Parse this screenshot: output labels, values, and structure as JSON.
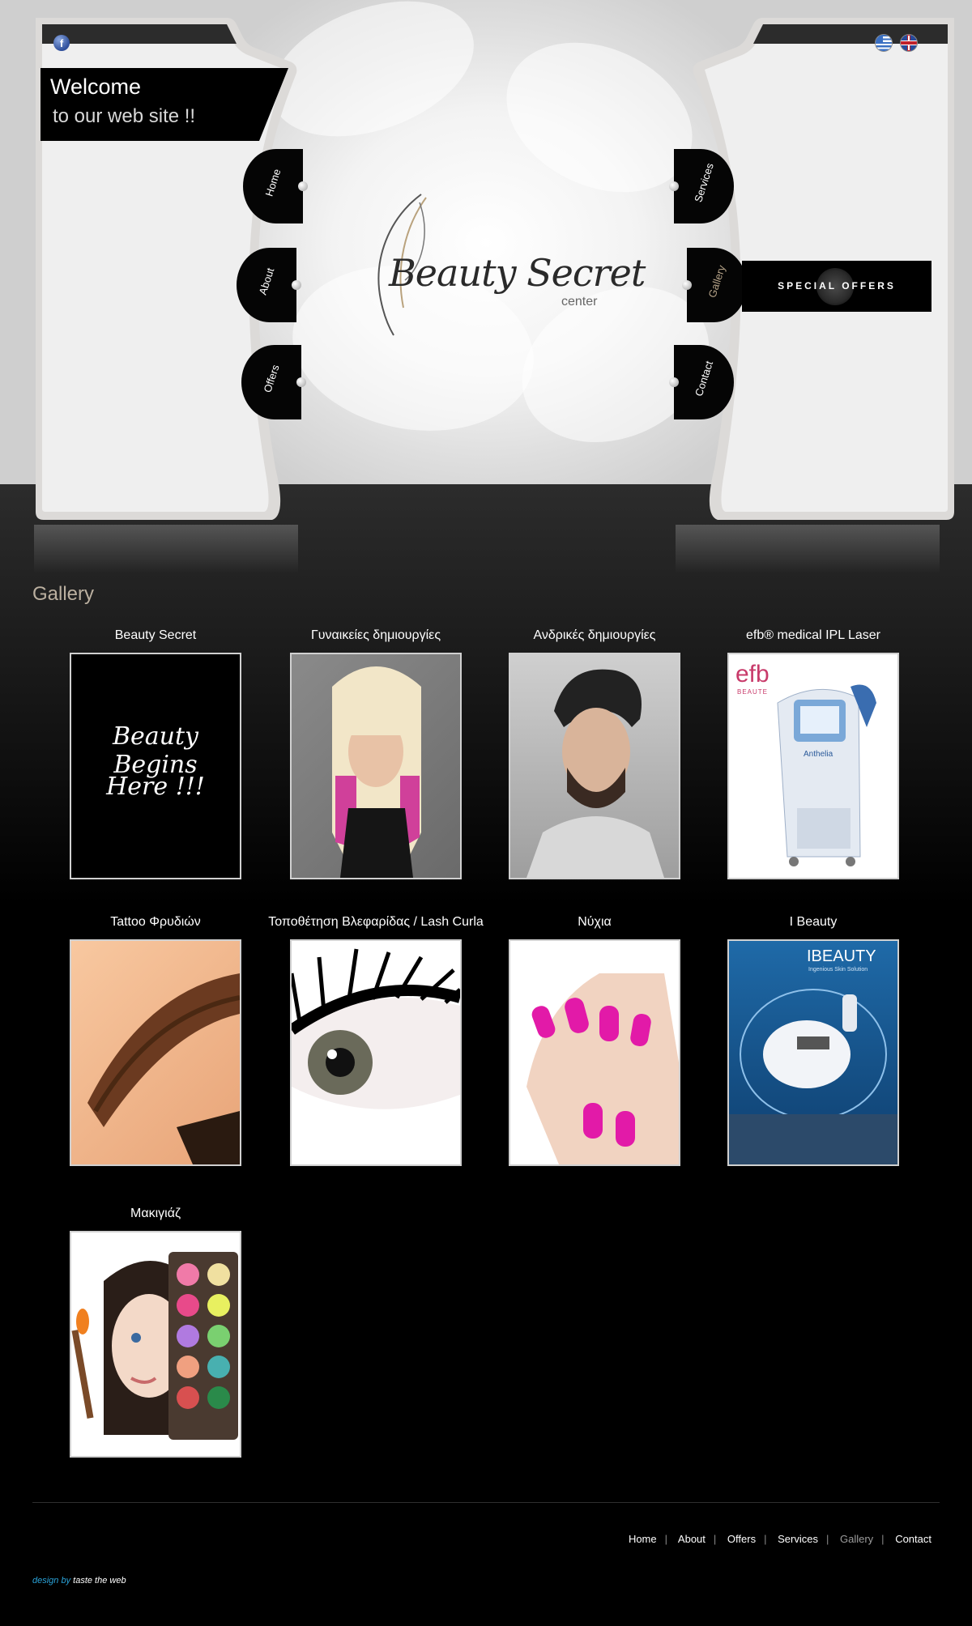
{
  "header": {
    "welcome_line1": "Welcome",
    "welcome_line2": "to our web site !!",
    "languages": [
      "el",
      "en"
    ],
    "facebook_icon": "facebook-icon"
  },
  "nav": {
    "left_tabs": [
      {
        "label": "Home"
      },
      {
        "label": "About"
      },
      {
        "label": "Offers"
      }
    ],
    "right_tabs": [
      {
        "label": "Services"
      },
      {
        "label": "Gallery",
        "active": true
      },
      {
        "label": "Contact"
      }
    ]
  },
  "logo": {
    "name": "Beauty Secret",
    "sub": "center"
  },
  "special_offers": "SPECIAL OFFERS",
  "gallery": {
    "title": "Gallery",
    "items": [
      {
        "caption": "Beauty Secret",
        "art_text_1": "Beauty Begins",
        "art_text_2": "Here !!!"
      },
      {
        "caption": "Γυναικείες δημιουργίες"
      },
      {
        "caption": "Ανδρικές δημιουργίες"
      },
      {
        "caption": "efb® medical IPL Laser",
        "art_brand": "efb",
        "art_sub": "BEAUTE",
        "art_device": "Anthelia"
      },
      {
        "caption": "Tattoo Φρυδιών"
      },
      {
        "caption": "Τοποθέτηση Βλεφαρίδας / Lash Curla"
      },
      {
        "caption": "Νύχια"
      },
      {
        "caption": "I Beauty",
        "art_brand": "IBEAUTY",
        "art_sub": "Ingenious Skin Solution"
      },
      {
        "caption": "Μακιγιάζ"
      }
    ]
  },
  "footer": {
    "links": [
      "Home",
      "About",
      "Offers",
      "Services",
      "Gallery",
      "Contact"
    ],
    "active": "Gallery",
    "credit_by": "design by",
    "credit_name": "taste the web"
  },
  "colors": {
    "accent": "#bbb0a0",
    "dark": "#000000",
    "panel": "#efefef",
    "credit": "#2aa2d8"
  }
}
